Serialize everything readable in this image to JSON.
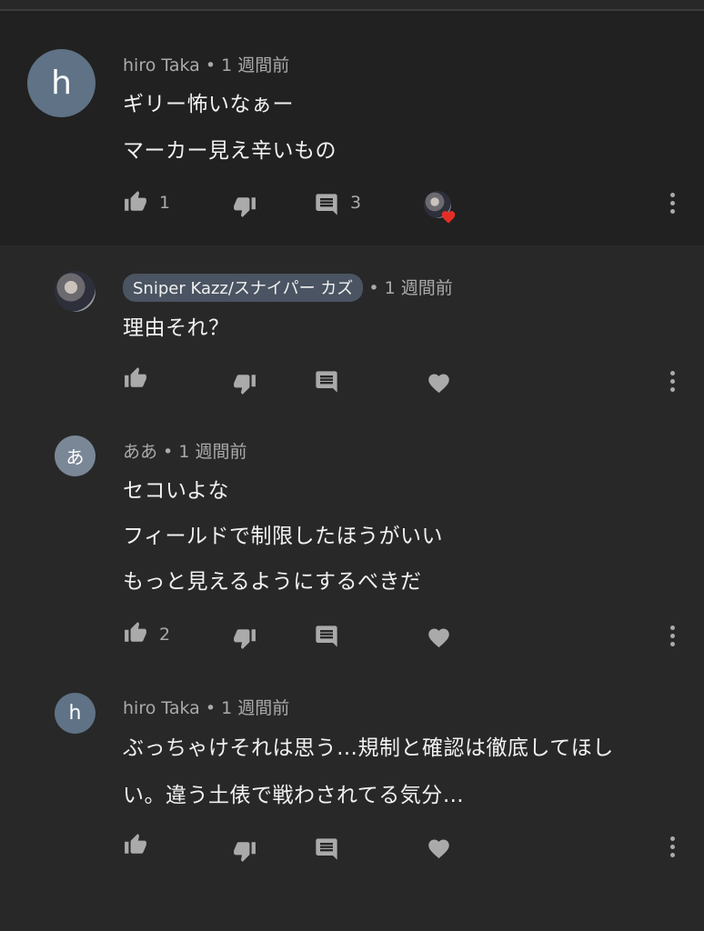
{
  "comments": [
    {
      "avatar_letter": "h",
      "author": "hiro Taka",
      "sep": " • ",
      "time": "1 週間前",
      "lines": [
        "ギリー怖いなぁー",
        "マーカー見え辛いもの"
      ],
      "likes": "1",
      "replies": "3",
      "hearted": true
    },
    {
      "author": "Sniper Kazz/スナイパー カズ",
      "sep": " • ",
      "time": "1 週間前",
      "lines": [
        "理由それ？"
      ]
    },
    {
      "avatar_letter": "あ",
      "author": "ああ",
      "sep": " • ",
      "time": "1 週間前",
      "lines": [
        "セコいよな",
        "フィールドで制限したほうがいい",
        "もっと見えるようにするべきだ"
      ],
      "likes": "2"
    },
    {
      "avatar_letter": "h",
      "author": "hiro Taka",
      "sep": " • ",
      "time": "1 週間前",
      "lines": [
        "ぶっちゃけそれは思う…規制と確認は徹底してほし",
        "い。違う土俵で戦わされてる気分…"
      ]
    }
  ],
  "colors": {
    "background": "#282828",
    "thread_background": "#212121",
    "avatar": "#5f7286",
    "channel_badge": "#4a5462",
    "icon": "#aaaaaa",
    "heart": "#e52d27"
  },
  "icons": {
    "like": "thumbs-up-icon",
    "dislike": "thumbs-down-icon",
    "reply": "comment-icon",
    "heart": "heart-icon",
    "more": "more-vertical-icon"
  }
}
